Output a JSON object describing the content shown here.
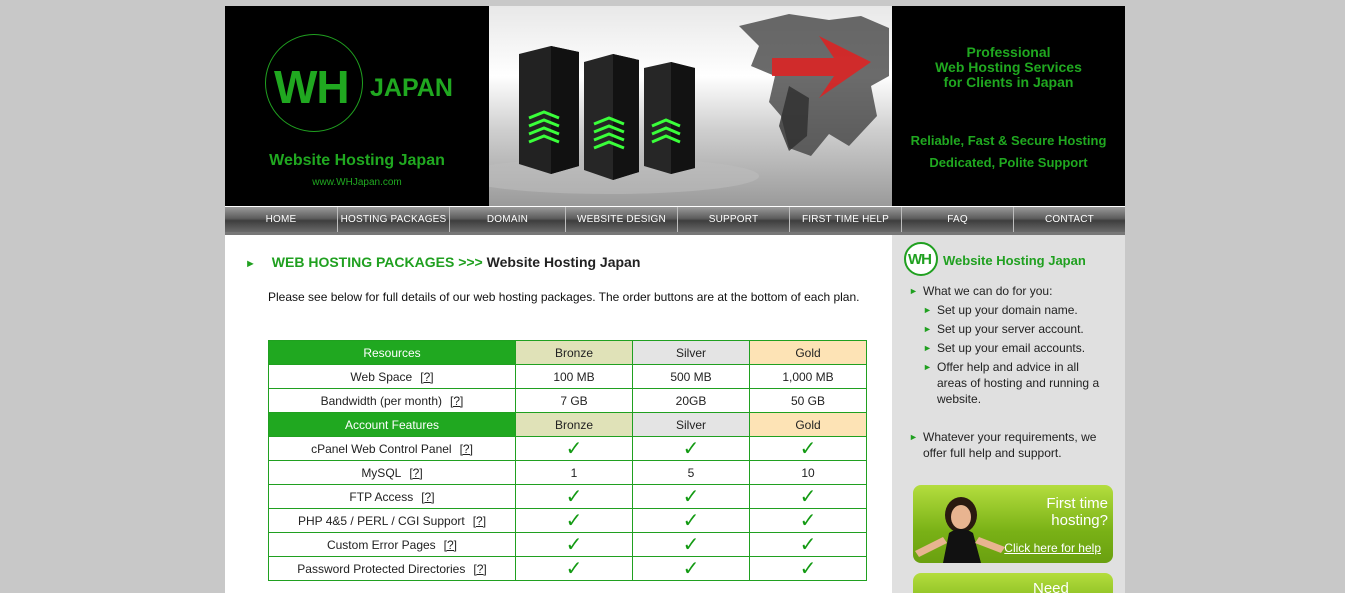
{
  "banner": {
    "logo_mark": "WH",
    "logo_word": "JAPAN",
    "tagline": "Website Hosting Japan",
    "url": "www.WHJapan.com",
    "info_lines": [
      "Professional",
      "Web Hosting Services",
      "for Clients in Japan",
      "Reliable, Fast & Secure Hosting",
      "Dedicated, Polite Support"
    ]
  },
  "nav": {
    "items": [
      "HOME",
      "HOSTING PACKAGES",
      "DOMAIN REGISTRATION",
      "WEBSITE DESIGN",
      "SUPPORT",
      "FIRST TIME HELP",
      "FAQ",
      "CONTACT"
    ]
  },
  "main": {
    "breadcrumb": "WEB HOSTING PACKAGES >>>",
    "title": "Website Hosting Japan",
    "intro": "Please see below for full details of our web hosting packages.  The order buttons are at the bottom of each plan.",
    "help_marker": "[?]",
    "tick": "✓",
    "table": {
      "rows": [
        {
          "type": "head",
          "label": "Resources",
          "values": [
            "Bronze",
            "Silver",
            "Gold"
          ]
        },
        {
          "type": "row",
          "label": "Web Space",
          "help": true,
          "values": [
            "100 MB",
            "500 MB",
            "1,000 MB"
          ]
        },
        {
          "type": "row",
          "label": "Bandwidth (per month)",
          "help": true,
          "values": [
            "7 GB",
            "20GB",
            "50 GB"
          ]
        },
        {
          "type": "head",
          "label": "Account Features",
          "values": [
            "Bronze",
            "Silver",
            "Gold"
          ]
        },
        {
          "type": "row",
          "label": "cPanel Web Control Panel",
          "help": true,
          "values": [
            "✓",
            "✓",
            "✓"
          ]
        },
        {
          "type": "row",
          "label": "MySQL",
          "help": true,
          "values": [
            "1",
            "5",
            "10"
          ]
        },
        {
          "type": "row",
          "label": "FTP Access",
          "help": true,
          "values": [
            "✓",
            "✓",
            "✓"
          ]
        },
        {
          "type": "row",
          "label": "PHP 4&5 / PERL / CGI Support",
          "help": true,
          "values": [
            "✓",
            "✓",
            "✓"
          ]
        },
        {
          "type": "row",
          "label": "Custom Error Pages",
          "help": true,
          "values": [
            "✓",
            "✓",
            "✓"
          ]
        },
        {
          "type": "row",
          "label": "Password Protected Directories",
          "help": true,
          "values": [
            "✓",
            "✓",
            "✓"
          ]
        }
      ]
    }
  },
  "sidebar": {
    "logo_mark": "WH",
    "title": "Website Hosting Japan",
    "intro": "What we can do for you:",
    "items": [
      "Set up your domain name.",
      "Set up your server account.",
      "Set up your email accounts.",
      "Offer help and advice in all areas of hosting and running a website."
    ],
    "closing": "Whatever your requirements, we offer full help and support.",
    "promo": {
      "title": "First time hosting?",
      "link": "Click here for help"
    },
    "promo2_title": "Need"
  },
  "colors": {
    "brand_green": "#20a820",
    "page_bg": "#c8c8c8",
    "sidebar_bg": "#e0e0e0"
  }
}
